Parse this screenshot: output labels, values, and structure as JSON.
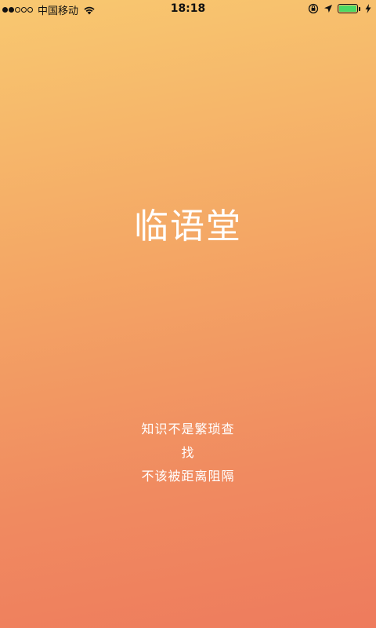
{
  "status_bar": {
    "carrier": "中国移动",
    "time": "18:18",
    "signal_bars_filled": 2,
    "signal_bars_total": 5,
    "battery_level": 1.0,
    "battery_color": "#4cd964"
  },
  "app": {
    "title": "临语堂",
    "tagline_lines": [
      "知识不是繁琐查",
      "找",
      "不该被距离阻隔"
    ]
  },
  "theme": {
    "gradient_top": "#f8c870",
    "gradient_bottom": "#ee7b5d",
    "text_color": "#ffffff"
  }
}
